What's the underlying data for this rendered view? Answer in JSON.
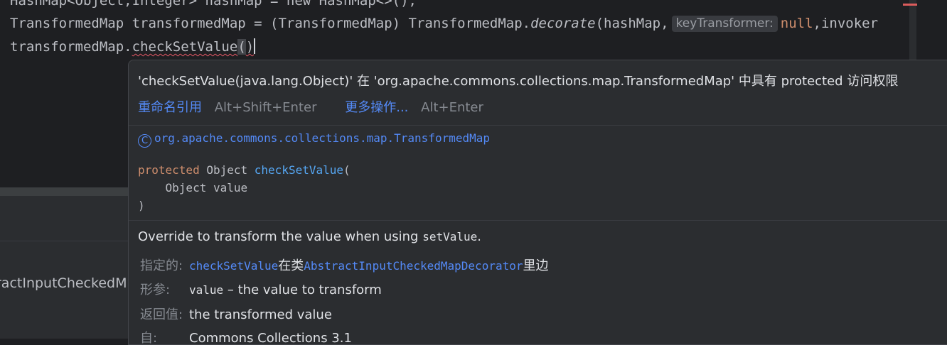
{
  "editor": {
    "line0_text": "HashMap<Object,Integer> hashMap = new HashMap<>();",
    "line1": {
      "pre": "TransformedMap transformedMap = (TransformedMap) TransformedMap.",
      "method": "decorate",
      "args_start": "(hashMap,",
      "hint": "keyTransformer:",
      "null_kw": "null",
      "rest": ",invoker"
    },
    "line2": {
      "obj": "transformedMap.",
      "method": "checkSetValue",
      "paren_open": "(",
      "paren_close": ")"
    }
  },
  "left_panel": {
    "truncated_text": "ractInputCheckedM"
  },
  "popup": {
    "error_message": "'checkSetValue(java.lang.Object)' 在 'org.apache.commons.collections.map.TransformedMap' 中具有 protected 访问权限",
    "actions": [
      {
        "label": "重命名引用",
        "shortcut": "Alt+Shift+Enter"
      },
      {
        "label": "更多操作...",
        "shortcut": "Alt+Enter"
      }
    ],
    "class_icon": "C",
    "class_name": "org.apache.commons.collections.map.TransformedMap",
    "signature": {
      "modifier": "protected",
      "return_type": "Object",
      "method_name": "checkSetValue",
      "open": "(",
      "param": "Object value",
      "close": ")"
    },
    "description_prefix": "Override to transform the value when using ",
    "description_code": "setValue",
    "description_suffix": ".",
    "specified_label": "指定的:",
    "specified_method": "checkSetValue",
    "specified_middle": "在类",
    "specified_class": "AbstractInputCheckedMapDecorator",
    "specified_suffix": "里边",
    "params_label": "形参:",
    "param_name": "value",
    "param_desc": " – the value to transform",
    "returns_label": "返回值:",
    "returns_value": "the transformed value",
    "since_label": "自:",
    "since_value": "Commons Collections 3.1"
  },
  "colors": {
    "editor_bg": "#1e1f22",
    "popup_bg": "#2b2d30",
    "link": "#548af7",
    "keyword": "#cf8e6d",
    "error": "#e55765"
  }
}
